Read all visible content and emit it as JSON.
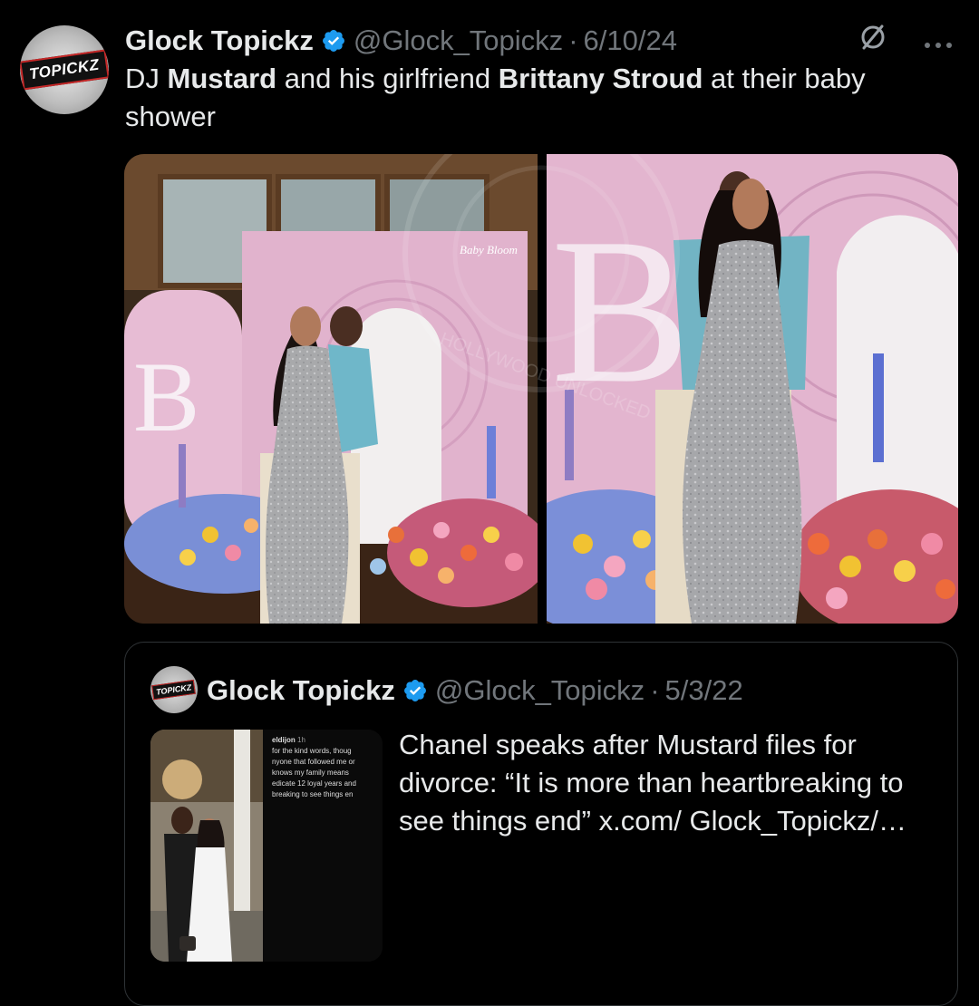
{
  "tweet": {
    "author_name": "Glock Topickz",
    "handle": "@Glock_Topickz",
    "separator": "·",
    "date": "6/10/24",
    "avatar_text": "TOPICKZ",
    "text_parts": {
      "p1": "DJ ",
      "b1": "Mustard",
      "p2": " and his girlfriend ",
      "b2": "Brittany Stroud",
      "p3": " at their baby shower"
    },
    "images": [
      {
        "alt": "Couple posing in front of pink B backdrop with flowers"
      },
      {
        "alt": "Close-up of couple posing at baby shower with flowers"
      }
    ],
    "watermark_text": "HOLLYWOOD UNLOCKED",
    "backdrop_letter": "B",
    "signage_text": "Baby Bloom"
  },
  "quoted": {
    "author_name": "Glock Topickz",
    "handle": "@Glock_Topickz",
    "separator": "·",
    "date": "5/3/22",
    "avatar_text": "TOPICKZ",
    "text": "Chanel speaks after Mustard files for divorce: “It is more than heartbreaking to see things end” x.com/ Glock_Topickz/…",
    "thumb_caption": {
      "user": "eldijon",
      "time": "1h",
      "lines": [
        "for the kind words, thoug",
        "nyone that followed me or",
        "knows my family means",
        "edicate 12 loyal years and",
        "breaking to see things en"
      ]
    }
  },
  "colors": {
    "background": "#000000",
    "text": "#e7e9ea",
    "muted": "#71767b",
    "verified": "#1d9bf0",
    "border": "#2f3336"
  },
  "icons": [
    "verified-badge-icon",
    "grok-icon",
    "more-icon"
  ]
}
